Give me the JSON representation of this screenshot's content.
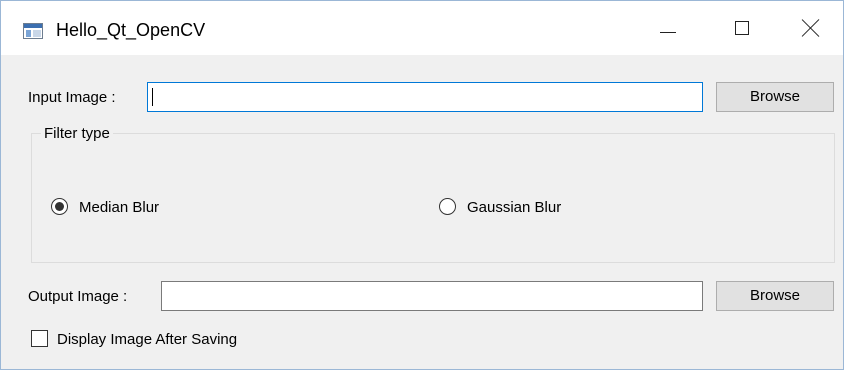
{
  "window": {
    "title": "Hello_Qt_OpenCV",
    "icon": "qt-app-window-icon",
    "controls": [
      "minimize-icon",
      "maximize-icon",
      "close-icon"
    ]
  },
  "input": {
    "label": "Input Image :",
    "value": "",
    "browse_label": "Browse"
  },
  "filter": {
    "group_title": "Filter type",
    "options": [
      {
        "label": "Median Blur",
        "checked": true
      },
      {
        "label": "Gaussian Blur",
        "checked": false
      }
    ]
  },
  "output": {
    "label": "Output Image :",
    "value": "",
    "browse_label": "Browse"
  },
  "display_after_saving": {
    "label": "Display Image After Saving",
    "checked": false
  },
  "colors": {
    "focus_border": "#0078d7",
    "window_bg": "#f0f0f0",
    "button_bg": "#e1e1e1"
  }
}
